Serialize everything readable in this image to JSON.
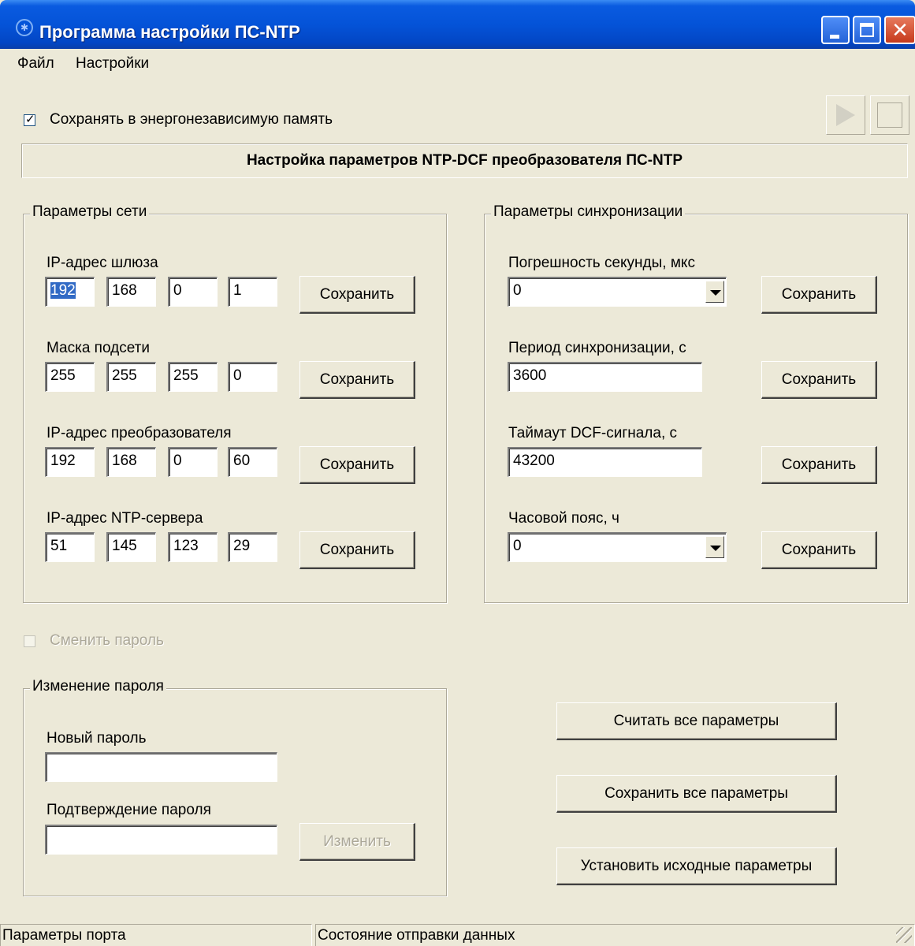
{
  "window": {
    "title": "Программа настройки ПС-NTP",
    "close_glyph": "✕"
  },
  "menu": {
    "file": "Файл",
    "settings": "Настройки"
  },
  "save_nvram": {
    "label": "Сохранять в энергонезависимую память",
    "checked": true
  },
  "banner": "Настройка параметров NTP-DCF преобразователя ПС-NTP",
  "network": {
    "title": "Параметры сети",
    "gateway": {
      "label": "IP-адрес шлюза",
      "octets": [
        "192",
        "168",
        "0",
        "1"
      ]
    },
    "mask": {
      "label": "Маска подсети",
      "octets": [
        "255",
        "255",
        "255",
        "0"
      ]
    },
    "converter": {
      "label": "IP-адрес преобразователя",
      "octets": [
        "192",
        "168",
        "0",
        "60"
      ]
    },
    "ntp": {
      "label": "IP-адрес NTP-сервера",
      "octets": [
        "51",
        "145",
        "123",
        "29"
      ]
    },
    "save_label": "Сохранить"
  },
  "sync": {
    "title": "Параметры синхронизации",
    "error": {
      "label": "Погрешность секунды, мкс",
      "value": "0"
    },
    "period": {
      "label": "Период синхронизации, с",
      "value": "3600"
    },
    "timeout": {
      "label": "Таймаут DCF-сигнала, с",
      "value": "43200"
    },
    "timezone": {
      "label": "Часовой пояс, ч",
      "value": "0"
    },
    "save_label": "Сохранить"
  },
  "change_password": {
    "label": "Сменить пароль",
    "checked": false,
    "enabled": false
  },
  "password": {
    "title": "Изменение пароля",
    "new_label": "Новый пароль",
    "new_value": "",
    "confirm_label": "Подтверждение пароля",
    "confirm_value": "",
    "change_button": "Изменить"
  },
  "actions": {
    "read_all": "Считать все параметры",
    "save_all": "Сохранить все параметры",
    "defaults": "Установить исходные параметры"
  },
  "status": {
    "port": "Параметры порта",
    "send": "Состояние отправки данных"
  }
}
